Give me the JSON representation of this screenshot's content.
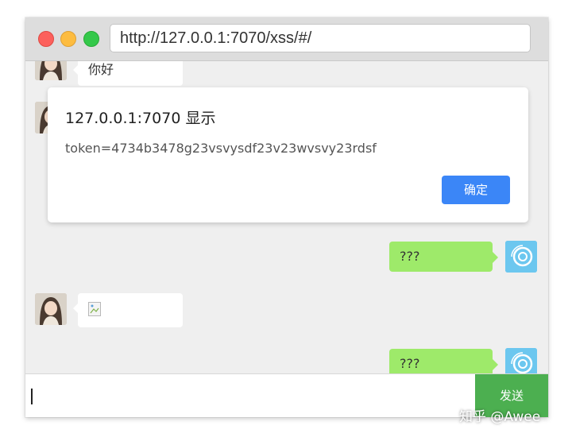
{
  "browser": {
    "url": "http://127.0.0.1:7070/xss/#/"
  },
  "messages": [
    {
      "side": "left",
      "text": "你好"
    },
    {
      "side": "right",
      "text": "???"
    },
    {
      "side": "left",
      "text": "",
      "content": "broken-image"
    },
    {
      "side": "right",
      "text": "???"
    }
  ],
  "alert": {
    "title": "127.0.0.1:7070 显示",
    "message": "token=4734b3478g23vsvysdf23v23wvsvy23rdsf",
    "ok_label": "确定"
  },
  "input": {
    "value": "",
    "send_label": "发送"
  },
  "watermark": "知乎 @Awee",
  "colors": {
    "sent_bubble": "#9eea6a",
    "send_button": "#4caf50",
    "ok_button": "#3b86f7",
    "chat_background": "#efefef"
  }
}
